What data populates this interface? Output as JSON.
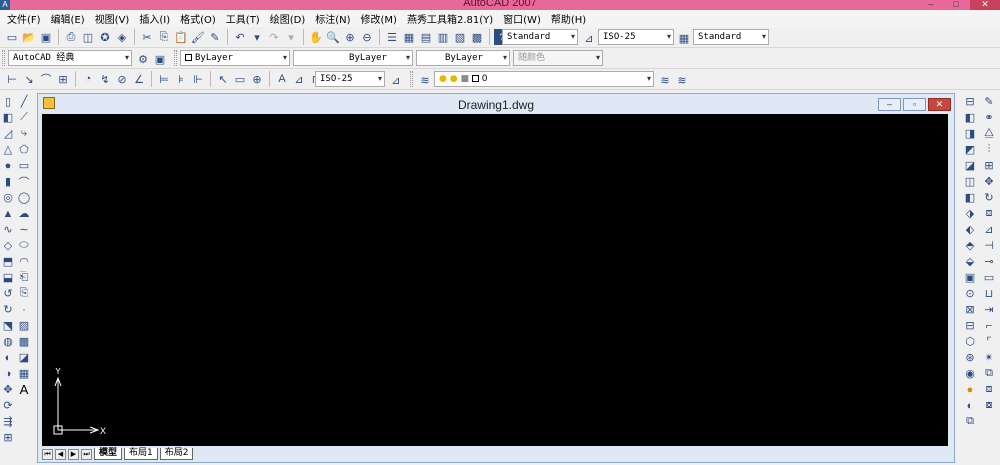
{
  "window": {
    "title": "AutoCAD 2007",
    "icon": "autocad-logo-icon",
    "minimize": "–",
    "maximize": "□",
    "close": "✕"
  },
  "menu": [
    "文件(F)",
    "编辑(E)",
    "视图(V)",
    "插入(I)",
    "格式(O)",
    "工具(T)",
    "绘图(D)",
    "标注(N)",
    "修改(M)",
    "燕秀工具箱2.81(Y)",
    "窗口(W)",
    "帮助(H)"
  ],
  "toolbars": {
    "text_style": "Standard",
    "dim_style": "ISO-25",
    "table_style": "Standard",
    "workspace": "AutoCAD 经典",
    "layer_color": "ByLayer",
    "linetype": "ByLayer",
    "lineweight": "ByLayer",
    "plot_style": "随颜色",
    "dim_style_2": "ISO-25",
    "layer": "0"
  },
  "drawing": {
    "title": "Drawing1.dwg",
    "ucs_x": "X",
    "ucs_y": "Y",
    "tabs": [
      "模型",
      "布局1",
      "布局2"
    ]
  },
  "colors": {
    "titlebar": "#e9689a",
    "canvas": "#000000",
    "close": "#c9463d"
  }
}
